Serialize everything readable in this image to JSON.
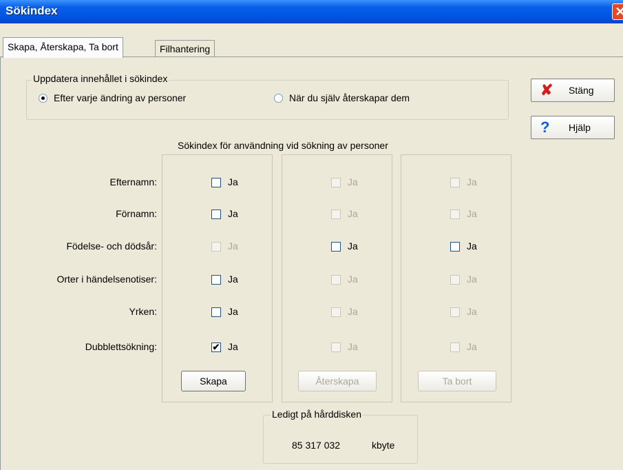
{
  "window": {
    "title": "Sökindex",
    "close_glyph": "✕"
  },
  "tabs": [
    {
      "label": "Skapa, Återskapa, Ta bort",
      "active": true
    },
    {
      "label": "Filhantering",
      "active": false
    }
  ],
  "update_group": {
    "legend": "Uppdatera innehållet i sökindex",
    "option_each_change": "Efter varje ändring av personer",
    "option_manual": "När du själv återskapar dem",
    "selected": "option_each_change"
  },
  "index_group": {
    "heading": "Sökindex för användning vid sökning av personer",
    "checkbox_label": "Ja",
    "rows": [
      {
        "label": "Efternamn:",
        "states": [
          {
            "checked": false,
            "enabled": true
          },
          {
            "checked": false,
            "enabled": false
          },
          {
            "checked": false,
            "enabled": false
          }
        ]
      },
      {
        "label": "Förnamn:",
        "states": [
          {
            "checked": false,
            "enabled": true
          },
          {
            "checked": false,
            "enabled": false
          },
          {
            "checked": false,
            "enabled": false
          }
        ]
      },
      {
        "label": "Födelse- och dödsår:",
        "states": [
          {
            "checked": false,
            "enabled": false
          },
          {
            "checked": false,
            "enabled": true
          },
          {
            "checked": false,
            "enabled": true
          }
        ]
      },
      {
        "label": "Orter i händelsenotiser:",
        "states": [
          {
            "checked": false,
            "enabled": true
          },
          {
            "checked": false,
            "enabled": false
          },
          {
            "checked": false,
            "enabled": false
          }
        ]
      },
      {
        "label": "Yrken:",
        "states": [
          {
            "checked": false,
            "enabled": true
          },
          {
            "checked": false,
            "enabled": false
          },
          {
            "checked": false,
            "enabled": false
          }
        ]
      },
      {
        "label": "Dubblettsökning:",
        "states": [
          {
            "checked": true,
            "enabled": true
          },
          {
            "checked": false,
            "enabled": false
          },
          {
            "checked": false,
            "enabled": false
          }
        ]
      }
    ],
    "actions": [
      {
        "label": "Skapa",
        "enabled": true
      },
      {
        "label": "Återskapa",
        "enabled": false
      },
      {
        "label": "Ta bort",
        "enabled": false
      }
    ]
  },
  "disk": {
    "legend": "Ledigt på hårddisken",
    "value": "85 317 032",
    "unit": "kbyte"
  },
  "side_buttons": {
    "close_label": "Stäng",
    "close_icon": "close-x-icon",
    "help_label": "Hjälp",
    "help_icon": "question-mark-icon"
  },
  "colors": {
    "titlebar": "#0054E3",
    "close_icon": "#D11F1F",
    "help_icon": "#1560D0",
    "dialog_bg": "#ECE9D8"
  }
}
